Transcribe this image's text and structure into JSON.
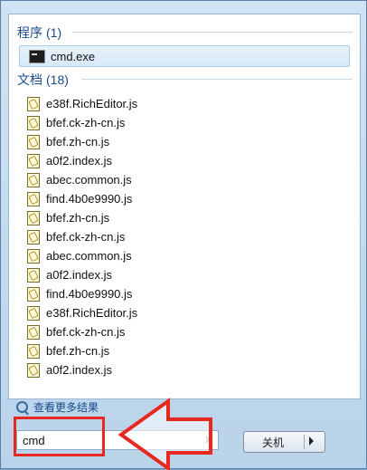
{
  "programs": {
    "header": "程序",
    "count": "(1)",
    "items": [
      {
        "label": "cmd.exe",
        "icon": "console-icon"
      }
    ]
  },
  "documents": {
    "header": "文档",
    "count": "(18)",
    "items": [
      {
        "label": "e38f.RichEditor.js"
      },
      {
        "label": "bfef.ck-zh-cn.js"
      },
      {
        "label": "bfef.zh-cn.js"
      },
      {
        "label": "a0f2.index.js"
      },
      {
        "label": "abec.common.js"
      },
      {
        "label": "find.4b0e9990.js"
      },
      {
        "label": "bfef.zh-cn.js"
      },
      {
        "label": "bfef.ck-zh-cn.js"
      },
      {
        "label": "abec.common.js"
      },
      {
        "label": "a0f2.index.js"
      },
      {
        "label": "find.4b0e9990.js"
      },
      {
        "label": "e38f.RichEditor.js"
      },
      {
        "label": "bfef.ck-zh-cn.js"
      },
      {
        "label": "bfef.zh-cn.js"
      },
      {
        "label": "a0f2.index.js"
      }
    ]
  },
  "see_more": {
    "label": "查看更多结果"
  },
  "search": {
    "value": "cmd"
  },
  "shutdown": {
    "label": "关机"
  },
  "colors": {
    "annotation": "#e8281f",
    "header_text": "#1a4a8a"
  }
}
